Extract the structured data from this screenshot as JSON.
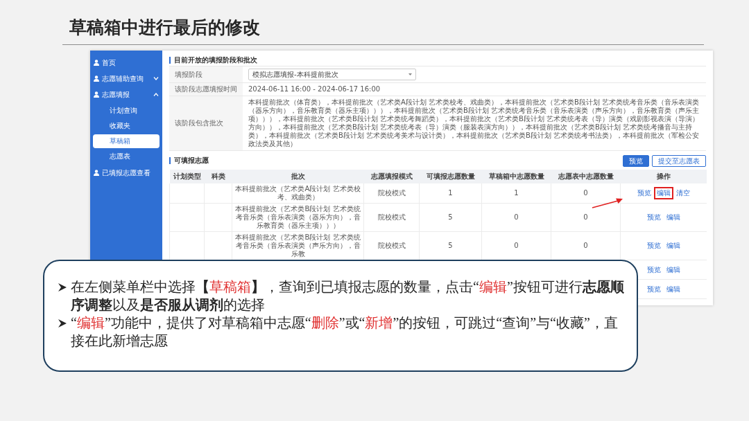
{
  "slide": {
    "title": "草稿箱中进行最后的修改"
  },
  "sidebar": {
    "items": [
      {
        "label": "首页"
      },
      {
        "label": "志愿辅助查询",
        "expanded": false
      },
      {
        "label": "志愿填报",
        "expanded": true,
        "children": [
          {
            "label": "计划查询",
            "selected": false
          },
          {
            "label": "收藏夹",
            "selected": false
          },
          {
            "label": "草稿箱",
            "selected": true
          },
          {
            "label": "志愿表",
            "selected": false
          }
        ]
      },
      {
        "label": "已填报志愿查看"
      }
    ]
  },
  "open_stage": {
    "heading": "目前开放的填报阶段和批次",
    "fields": [
      {
        "kind": "select",
        "label": "填报阶段",
        "value": "模拟志愿填报-本科提前批次"
      },
      {
        "kind": "text",
        "label": "该阶段志愿填报时间",
        "value": "2024-06-11 16:00 - 2024-06-17 16:00"
      },
      {
        "kind": "text",
        "label": "该阶段包含批次",
        "value": "本科提前批次（体育类），本科提前批次（艺术类A段计划 艺术类校考、戏曲类），本科提前批次（艺术类B段计划 艺术类统考音乐类（音乐表演类（器乐方向），音乐教育类（器乐主项））），本科提前批次（艺术类B段计划 艺术类统考音乐类（音乐表演类（声乐方向），音乐教育类（声乐主项））），本科提前批次（艺术类B段计划 艺术类统考舞蹈类），本科提前批次（艺术类B段计划 艺术类统考表（导）演类（戏剧影视表演（导演）方向）），本科提前批次（艺术类B段计划 艺术类统考表（导）演类（服装表演方向）），本科提前批次（艺术类B段计划 艺术类统考播音与主持类），本科提前批次（艺术类B段计划 艺术类统考美术与设计类），本科提前批次（艺术类B段计划 艺术类统考书法类），本科提前批次（军检公安政法类及其他）"
      }
    ]
  },
  "wishes": {
    "heading": "可填报志愿",
    "buttons": [
      {
        "label": "预览",
        "kind": "primary"
      },
      {
        "label": "提交至志愿表",
        "kind": "outline"
      }
    ],
    "columns": [
      "计划类型",
      "科类",
      "批次",
      "志愿填报模式",
      "可填报志愿数量",
      "草稿箱中志愿数量",
      "志愿表中志愿数量",
      "操作"
    ],
    "rows": [
      {
        "batch": "本科提前批次（艺术类A段计划 艺术类校考、戏曲类）",
        "mode": "院校模式",
        "available": "1",
        "draft": "1",
        "in_table": "0",
        "actions": [
          {
            "label": "预览",
            "highlighted": false
          },
          {
            "label": "编辑",
            "highlighted": true
          },
          {
            "label": "清空",
            "highlighted": false
          }
        ]
      },
      {
        "batch": "本科提前批次（艺术类B段计划 艺术类统考音乐类（音乐表演类（器乐方向），音乐教育类（器乐主项）））",
        "mode": "院校模式",
        "available": "5",
        "draft": "0",
        "in_table": "0",
        "actions": [
          {
            "label": "预览",
            "highlighted": false
          },
          {
            "label": "编辑",
            "highlighted": false
          }
        ]
      },
      {
        "batch": "本科提前批次（艺术类B段计划 艺术类统考音乐类（音乐表演类（声乐方向），音乐教",
        "mode": "院校模式",
        "available": "5",
        "draft": "0",
        "in_table": "0",
        "actions": [
          {
            "label": "预览",
            "highlighted": false
          },
          {
            "label": "编辑",
            "highlighted": false
          }
        ]
      },
      {
        "actions": [
          {
            "label": "预览",
            "highlighted": false
          },
          {
            "label": "编辑",
            "highlighted": false
          }
        ]
      },
      {
        "actions": [
          {
            "label": "预览",
            "highlighted": false
          },
          {
            "label": "编辑",
            "highlighted": false
          }
        ]
      }
    ]
  },
  "callout": {
    "bullets": [
      [
        {
          "kind": "plain",
          "text": "在左侧菜单栏中选择"
        },
        {
          "kind": "bold",
          "text": "【"
        },
        {
          "kind": "red",
          "text": "草稿箱"
        },
        {
          "kind": "bold",
          "text": "】"
        },
        {
          "kind": "plain",
          "text": "，查询到已填报志愿的数量，点击“"
        },
        {
          "kind": "red",
          "text": "编辑"
        },
        {
          "kind": "plain",
          "text": "”按钮可进行"
        },
        {
          "kind": "bold",
          "text": "志愿顺序调整"
        },
        {
          "kind": "plain",
          "text": "以及"
        },
        {
          "kind": "bold",
          "text": "是否服从调剂"
        },
        {
          "kind": "plain",
          "text": "的选择"
        }
      ],
      [
        {
          "kind": "plain",
          "text": "“"
        },
        {
          "kind": "red",
          "text": "编辑"
        },
        {
          "kind": "plain",
          "text": "”功能中，提供了对草稿箱中志愿“"
        },
        {
          "kind": "red",
          "text": "删除"
        },
        {
          "kind": "plain",
          "text": "”或“"
        },
        {
          "kind": "red",
          "text": "新增"
        },
        {
          "kind": "plain",
          "text": "”的按钮，可跳过“查询”与“收藏”，直接在此新增志愿"
        }
      ]
    ]
  }
}
